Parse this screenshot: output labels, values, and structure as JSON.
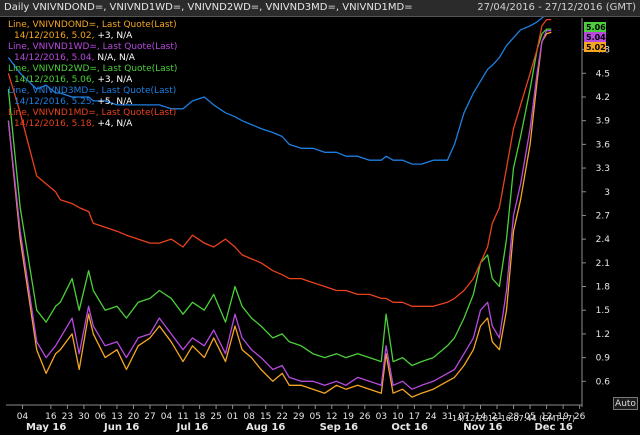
{
  "header": {
    "title": "Daily VNIVNDOND=, VNIVND1WD=, VNIVND2WD=, VNIVND3MD=, VNIVND1MD=",
    "date_range": "27/04/2016 - 27/12/2016 (GMT)"
  },
  "timestamp": "14/12/2016 16:07:44 (GMT+7)",
  "auto_button": "Auto",
  "colors": {
    "background": "#000000",
    "axis": "#8c8c8c",
    "tick_text": "#e6e6e6"
  },
  "chart_data": {
    "type": "line",
    "x": [
      "2016-04-28",
      "2016-05-03",
      "2016-05-10",
      "2016-05-14",
      "2016-05-18",
      "2016-05-20",
      "2016-05-25",
      "2016-05-28",
      "2016-06-01",
      "2016-06-03",
      "2016-06-08",
      "2016-06-13",
      "2016-06-17",
      "2016-06-22",
      "2016-06-27",
      "2016-07-01",
      "2016-07-06",
      "2016-07-11",
      "2016-07-15",
      "2016-07-20",
      "2016-07-24",
      "2016-07-29",
      "2016-08-02",
      "2016-08-05",
      "2016-08-09",
      "2016-08-13",
      "2016-08-18",
      "2016-08-22",
      "2016-08-25",
      "2016-08-30",
      "2016-09-04",
      "2016-09-09",
      "2016-09-14",
      "2016-09-18",
      "2016-09-23",
      "2016-09-28",
      "2016-10-03",
      "2016-10-05",
      "2016-10-08",
      "2016-10-12",
      "2016-10-16",
      "2016-10-20",
      "2016-10-25",
      "2016-10-31",
      "2016-11-03",
      "2016-11-07",
      "2016-11-11",
      "2016-11-14",
      "2016-11-17",
      "2016-11-19",
      "2016-11-22",
      "2016-11-25",
      "2016-11-28",
      "2016-12-01",
      "2016-12-05",
      "2016-12-08",
      "2016-12-10",
      "2016-12-12",
      "2016-12-14"
    ],
    "series": [
      {
        "name": "VNIVNDOND=",
        "color": "#f5a623",
        "values": [
          3.9,
          2.4,
          1.0,
          0.7,
          0.95,
          1.0,
          1.2,
          0.75,
          1.45,
          1.2,
          0.9,
          1.0,
          0.75,
          1.05,
          1.15,
          1.3,
          1.1,
          0.85,
          1.05,
          0.9,
          1.15,
          0.85,
          1.3,
          1.0,
          0.9,
          0.75,
          0.6,
          0.7,
          0.55,
          0.55,
          0.5,
          0.45,
          0.55,
          0.5,
          0.55,
          0.5,
          0.45,
          0.95,
          0.45,
          0.5,
          0.4,
          0.45,
          0.5,
          0.6,
          0.65,
          0.8,
          1.0,
          1.3,
          1.4,
          1.1,
          1.0,
          1.5,
          2.5,
          2.9,
          3.6,
          4.4,
          4.9,
          5.0,
          5.02
        ]
      },
      {
        "name": "VNIVND1WD=",
        "color": "#b84ae0",
        "values": [
          3.9,
          2.5,
          1.1,
          0.9,
          1.05,
          1.15,
          1.4,
          0.95,
          1.55,
          1.3,
          1.05,
          1.1,
          0.9,
          1.15,
          1.2,
          1.4,
          1.2,
          1.0,
          1.15,
          1.05,
          1.25,
          0.95,
          1.45,
          1.15,
          1.0,
          0.9,
          0.75,
          0.8,
          0.65,
          0.6,
          0.6,
          0.55,
          0.6,
          0.55,
          0.65,
          0.6,
          0.55,
          1.05,
          0.55,
          0.6,
          0.5,
          0.55,
          0.6,
          0.7,
          0.75,
          0.95,
          1.15,
          1.5,
          1.6,
          1.3,
          1.15,
          1.75,
          2.7,
          3.1,
          3.8,
          4.5,
          4.9,
          5.04,
          5.04
        ]
      },
      {
        "name": "VNIVND2WD=",
        "color": "#4ccf3a",
        "values": [
          4.3,
          2.8,
          1.5,
          1.35,
          1.55,
          1.6,
          1.9,
          1.5,
          2.0,
          1.75,
          1.5,
          1.55,
          1.4,
          1.6,
          1.65,
          1.75,
          1.65,
          1.45,
          1.6,
          1.5,
          1.7,
          1.35,
          1.8,
          1.55,
          1.4,
          1.3,
          1.15,
          1.2,
          1.1,
          1.05,
          0.95,
          0.9,
          0.95,
          0.9,
          0.95,
          0.9,
          0.85,
          1.45,
          0.85,
          0.9,
          0.8,
          0.85,
          0.9,
          1.05,
          1.15,
          1.4,
          1.7,
          2.1,
          2.2,
          1.9,
          1.8,
          2.4,
          3.3,
          3.7,
          4.3,
          4.8,
          5.0,
          5.06,
          5.06
        ]
      },
      {
        "name": "VNIVND1MD=",
        "color": "#e8421c",
        "values": [
          4.5,
          4.0,
          3.2,
          3.1,
          3.0,
          2.9,
          2.85,
          2.8,
          2.75,
          2.6,
          2.55,
          2.5,
          2.45,
          2.4,
          2.35,
          2.35,
          2.4,
          2.3,
          2.45,
          2.35,
          2.3,
          2.4,
          2.3,
          2.2,
          2.15,
          2.1,
          2.0,
          1.95,
          1.9,
          1.9,
          1.85,
          1.8,
          1.75,
          1.75,
          1.7,
          1.7,
          1.65,
          1.65,
          1.6,
          1.6,
          1.55,
          1.55,
          1.55,
          1.6,
          1.65,
          1.75,
          1.9,
          2.1,
          2.3,
          2.6,
          2.8,
          3.3,
          3.8,
          4.1,
          4.5,
          4.8,
          5.1,
          5.18,
          5.18
        ]
      },
      {
        "name": "VNIVND3MD=",
        "color": "#1e7fe0",
        "values": [
          4.7,
          4.5,
          4.3,
          4.35,
          4.25,
          4.25,
          4.2,
          4.2,
          4.2,
          4.15,
          4.15,
          4.1,
          4.1,
          4.1,
          4.1,
          4.1,
          4.05,
          4.05,
          4.15,
          4.2,
          4.1,
          4.0,
          3.95,
          3.9,
          3.85,
          3.8,
          3.75,
          3.7,
          3.6,
          3.55,
          3.55,
          3.5,
          3.5,
          3.45,
          3.45,
          3.4,
          3.4,
          3.45,
          3.4,
          3.4,
          3.35,
          3.35,
          3.4,
          3.4,
          3.6,
          4.0,
          4.25,
          4.4,
          4.55,
          4.6,
          4.7,
          4.85,
          4.95,
          5.05,
          5.1,
          5.15,
          5.2,
          5.25,
          5.25
        ]
      }
    ],
    "legend": [
      {
        "line1": "Line, VNIVNDOND=, Last Quote(Last)",
        "line2_date": "14/12/2016,",
        "line2_value": "5.02,",
        "line2_change": "+3, N/A",
        "color": "#f5a623"
      },
      {
        "line1": "Line, VNIVND1WD=, Last Quote(Last)",
        "line2_date": "14/12/2016,",
        "line2_value": "5.04,",
        "line2_change": "N/A, N/A",
        "color": "#b84ae0"
      },
      {
        "line1": "Line, VNIVND2WD=, Last Quote(Last)",
        "line2_date": "14/12/2016,",
        "line2_value": "5.06,",
        "line2_change": "+3, N/A",
        "color": "#4ccf3a"
      },
      {
        "line1": "Line, VNIVND3MD=, Last Quote(Last)",
        "line2_date": "14/12/2016,",
        "line2_value": "5.25,",
        "line2_change": "+5, N/A",
        "color": "#1e7fe0"
      },
      {
        "line1": "Line, VNIVND1MD=, Last Quote(Last)",
        "line2_date": "14/12/2016,",
        "line2_value": "5.18,",
        "line2_change": "+4, N/A",
        "color": "#e8421c"
      }
    ],
    "last_value_tags": [
      {
        "text": "5.06",
        "color": "#4ccf3a"
      },
      {
        "text": "5.04",
        "color": "#b84ae0"
      },
      {
        "text": "5.02",
        "color": "#f5a623"
      }
    ],
    "ylim": [
      0.3,
      5.2
    ],
    "yticks": [
      {
        "value": 0.6,
        "label": "0.6"
      },
      {
        "value": 0.9,
        "label": "0.9"
      },
      {
        "value": 1.2,
        "label": "1.2"
      },
      {
        "value": 1.5,
        "label": "1.5"
      },
      {
        "value": 1.8,
        "label": "1.8"
      },
      {
        "value": 2.1,
        "label": "2.1"
      },
      {
        "value": 2.4,
        "label": "2.4"
      },
      {
        "value": 2.7,
        "label": "2.7"
      },
      {
        "value": 3.0,
        "label": "3"
      },
      {
        "value": 3.3,
        "label": "3.3"
      },
      {
        "value": 3.6,
        "label": "3.6"
      },
      {
        "value": 3.9,
        "label": "3.9"
      },
      {
        "value": 4.2,
        "label": "4.2"
      },
      {
        "value": 4.5,
        "label": "4.5"
      },
      {
        "value": 4.8,
        "label": "4.8"
      }
    ],
    "xlim": [
      "2016-04-27",
      "2016-12-27"
    ],
    "xticks": [
      {
        "date": "2016-05-04",
        "label": "04"
      },
      {
        "date": "2016-05-16",
        "label": "16"
      },
      {
        "date": "2016-05-23",
        "label": "23"
      },
      {
        "date": "2016-05-30",
        "label": "30"
      },
      {
        "date": "2016-06-06",
        "label": "06"
      },
      {
        "date": "2016-06-13",
        "label": "13"
      },
      {
        "date": "2016-06-20",
        "label": "20"
      },
      {
        "date": "2016-06-27",
        "label": "27"
      },
      {
        "date": "2016-07-04",
        "label": "04"
      },
      {
        "date": "2016-07-11",
        "label": "11"
      },
      {
        "date": "2016-07-18",
        "label": "18"
      },
      {
        "date": "2016-07-25",
        "label": "25"
      },
      {
        "date": "2016-08-01",
        "label": "01"
      },
      {
        "date": "2016-08-08",
        "label": "08"
      },
      {
        "date": "2016-08-15",
        "label": "15"
      },
      {
        "date": "2016-08-22",
        "label": "22"
      },
      {
        "date": "2016-08-29",
        "label": "29"
      },
      {
        "date": "2016-09-05",
        "label": "05"
      },
      {
        "date": "2016-09-12",
        "label": "12"
      },
      {
        "date": "2016-09-19",
        "label": "19"
      },
      {
        "date": "2016-09-26",
        "label": "26"
      },
      {
        "date": "2016-10-03",
        "label": "03"
      },
      {
        "date": "2016-10-10",
        "label": "10"
      },
      {
        "date": "2016-10-17",
        "label": "17"
      },
      {
        "date": "2016-10-24",
        "label": "24"
      },
      {
        "date": "2016-10-31",
        "label": "31"
      },
      {
        "date": "2016-11-07",
        "label": "07"
      },
      {
        "date": "2016-11-14",
        "label": "14"
      },
      {
        "date": "2016-11-21",
        "label": "21"
      },
      {
        "date": "2016-11-28",
        "label": "28"
      },
      {
        "date": "2016-12-05",
        "label": "05"
      },
      {
        "date": "2016-12-12",
        "label": "12"
      },
      {
        "date": "2016-12-19",
        "label": "19"
      },
      {
        "date": "2016-12-26",
        "label": "26"
      }
    ],
    "month_labels": [
      {
        "date": "2016-05-14",
        "label": "May 16"
      },
      {
        "date": "2016-06-15",
        "label": "Jun 16"
      },
      {
        "date": "2016-07-15",
        "label": "Jul 16"
      },
      {
        "date": "2016-08-15",
        "label": "Aug 16"
      },
      {
        "date": "2016-09-15",
        "label": "Sep 16"
      },
      {
        "date": "2016-10-15",
        "label": "Oct 16"
      },
      {
        "date": "2016-11-15",
        "label": "Nov 16"
      },
      {
        "date": "2016-12-15",
        "label": "Dec 16"
      }
    ],
    "grid": false,
    "legend_position": "top-left"
  }
}
